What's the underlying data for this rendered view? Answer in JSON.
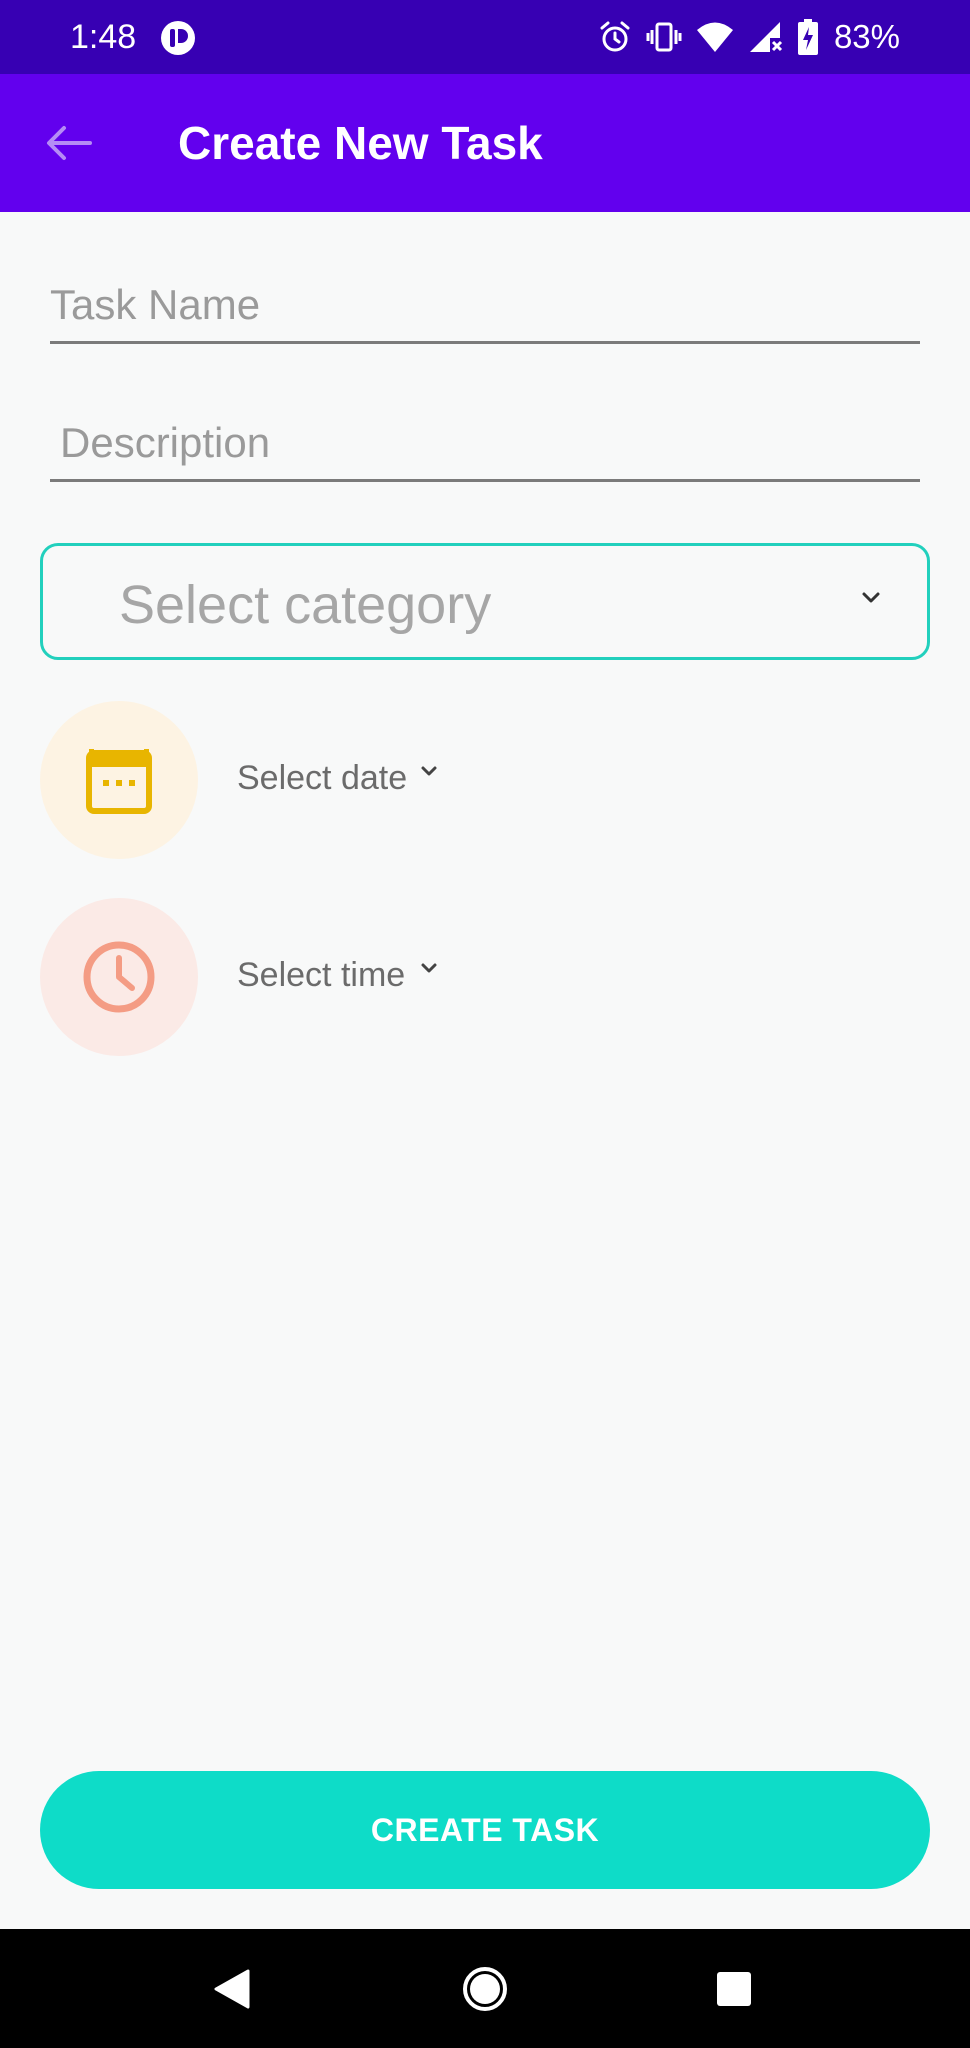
{
  "status_bar": {
    "time": "1:48",
    "battery": "83%",
    "icons": [
      "app-notification-icon",
      "alarm-icon",
      "vibrate-icon",
      "wifi-icon",
      "signal-icon",
      "battery-charging-icon"
    ]
  },
  "app_bar": {
    "title": "Create New Task",
    "back_icon": "arrow-back-icon"
  },
  "form": {
    "task_name_placeholder": "Task Name",
    "task_name_value": "",
    "description_placeholder": "Description",
    "description_value": "",
    "category_label": "Select category",
    "date_label": "Select date",
    "time_label": "Select time",
    "date_icon": "calendar-icon",
    "time_icon": "clock-icon"
  },
  "actions": {
    "create_label": "CREATE TASK"
  },
  "colors": {
    "status_bar": "#3700b3",
    "app_bar": "#6200ee",
    "accent": "#0edcc8",
    "category_border": "#22d0bd",
    "calendar_icon": "#e8b500",
    "calendar_bg": "#fdf3e3",
    "clock_icon": "#f49c84",
    "clock_bg": "#fbeae6"
  },
  "navigation_bar": {
    "buttons": [
      "nav-back-icon",
      "nav-home-icon",
      "nav-recents-icon"
    ]
  }
}
